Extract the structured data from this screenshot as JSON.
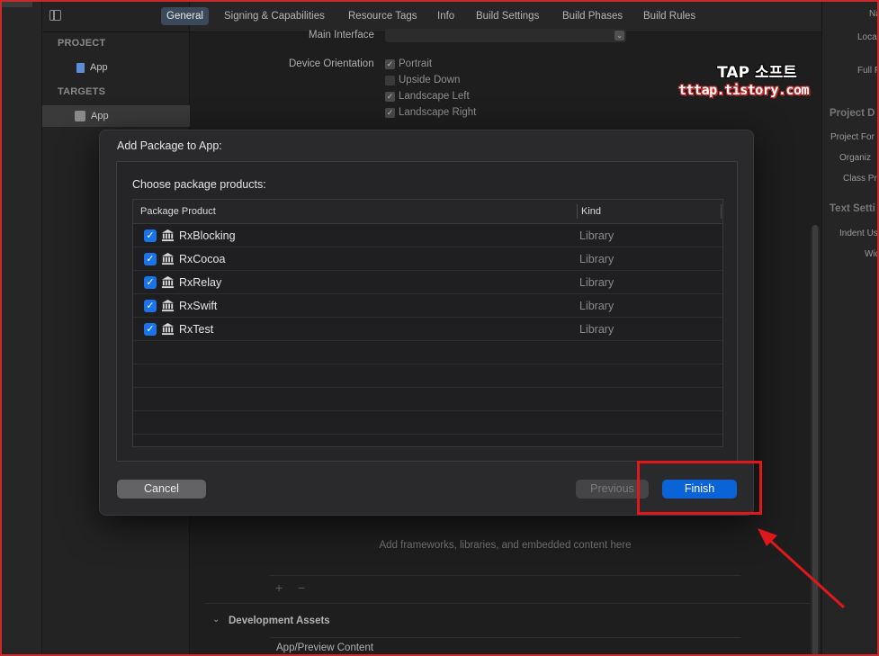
{
  "tabs": [
    "General",
    "Signing & Capabilities",
    "Resource Tags",
    "Info",
    "Build Settings",
    "Build Phases",
    "Build Rules"
  ],
  "active_tab": "General",
  "navigator": {
    "project_header": "PROJECT",
    "project_item": "App",
    "targets_header": "TARGETS",
    "target_item": "App"
  },
  "general": {
    "main_interface_label": "Main Interface",
    "device_orientation_label": "Device Orientation",
    "orientations": [
      {
        "label": "Portrait",
        "checked": true
      },
      {
        "label": "Upside Down",
        "checked": false
      },
      {
        "label": "Landscape Left",
        "checked": true
      },
      {
        "label": "Landscape Right",
        "checked": true
      }
    ],
    "frameworks_hint": "Add frameworks, libraries, and embedded content here",
    "plus_label": "+",
    "minus_label": "−",
    "dev_assets_title": "Development Assets",
    "app_preview_content": "App/Preview Content"
  },
  "inspector": {
    "name_label": "Na",
    "location_label": "Loca",
    "full_path_label": "Full P",
    "project_doc_header": "Project D",
    "project_format_label": "Project For",
    "organization_label": "Organiz",
    "class_prefix_label": "Class Pr",
    "text_settings_header": "Text Setti",
    "indent_label": "Indent Us",
    "widths_label": "Wid"
  },
  "watermark": {
    "title": "TAP 소프트",
    "url": "tttap.tistory.com"
  },
  "dialog": {
    "title": "Add Package to App:",
    "subtitle": "Choose package products:",
    "col_product": "Package Product",
    "col_kind": "Kind",
    "products": [
      {
        "name": "RxBlocking",
        "kind": "Library",
        "checked": true
      },
      {
        "name": "RxCocoa",
        "kind": "Library",
        "checked": true
      },
      {
        "name": "RxRelay",
        "kind": "Library",
        "checked": true
      },
      {
        "name": "RxSwift",
        "kind": "Library",
        "checked": true
      },
      {
        "name": "RxTest",
        "kind": "Library",
        "checked": true
      }
    ],
    "cancel_label": "Cancel",
    "previous_label": "Previous",
    "finish_label": "Finish"
  },
  "colors": {
    "accent": "#0a64d8",
    "highlight": "#e0181b"
  }
}
